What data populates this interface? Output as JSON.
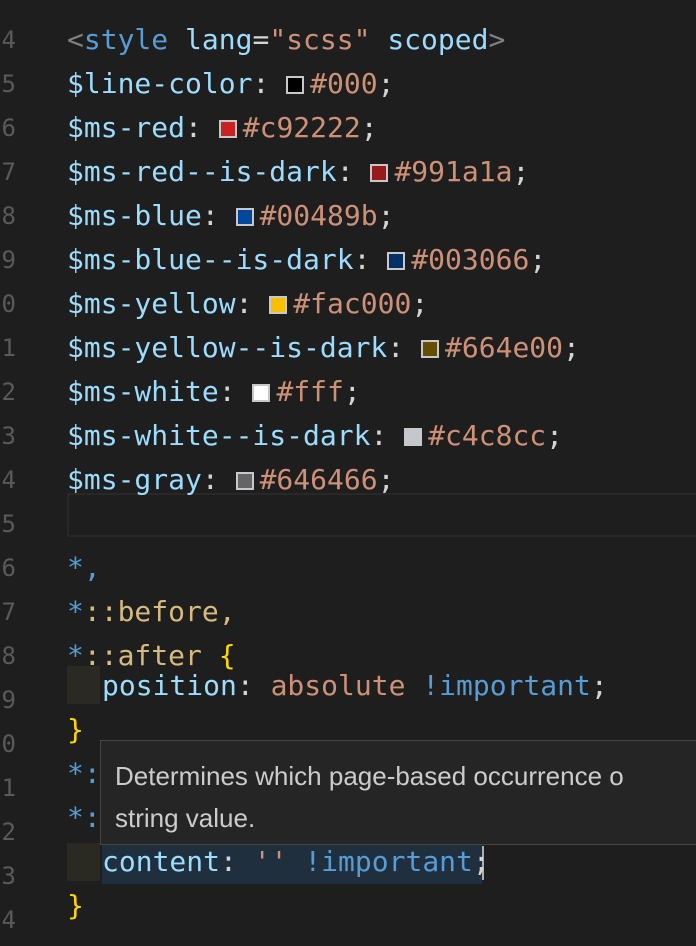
{
  "gutter_numbers": [
    "4",
    "5",
    "6",
    "7",
    "8",
    "9",
    "0",
    "1",
    "2",
    "3",
    "4",
    "5",
    "6",
    "7",
    "8",
    "9",
    "0",
    "1",
    "2",
    "3",
    "4"
  ],
  "code": {
    "l1": {
      "open": "<",
      "tag": "style",
      "attr1": "lang",
      "eq": "=",
      "str": "\"scss\"",
      "attr2": "scoped",
      "close": ">"
    },
    "vars": [
      {
        "name": "$line-color",
        "color": "#000000",
        "value": "#000"
      },
      {
        "name": "$ms-red",
        "color": "#c92222",
        "value": "#c92222"
      },
      {
        "name": "$ms-red--is-dark",
        "color": "#991a1a",
        "value": "#991a1a"
      },
      {
        "name": "$ms-blue",
        "color": "#00489b",
        "value": "#00489b"
      },
      {
        "name": "$ms-blue--is-dark",
        "color": "#003066",
        "value": "#003066"
      },
      {
        "name": "$ms-yellow",
        "color": "#fac000",
        "value": "#fac000"
      },
      {
        "name": "$ms-yellow--is-dark",
        "color": "#664e00",
        "value": "#664e00"
      },
      {
        "name": "$ms-white",
        "color": "#ffffff",
        "value": "#fff"
      },
      {
        "name": "$ms-white--is-dark",
        "color": "#c4c8cc",
        "value": "#c4c8cc"
      },
      {
        "name": "$ms-gray",
        "color": "#646466",
        "value": "#646466"
      }
    ],
    "sel1": "*,",
    "sel2_star": "*",
    "sel2_pseudo": "::before,",
    "sel3_star": "*",
    "sel3_pseudo": "::after",
    "open_brace": "{",
    "decl1_prop": "position",
    "decl1_val": "absolute",
    "decl1_imp": "!important",
    "close_brace": "}",
    "sel4_star": "*:",
    "sel5_star": "*:",
    "decl2_prop": "content",
    "decl2_val": "''",
    "decl2_imp": "!important",
    "close_brace2": "}"
  },
  "tooltip": {
    "line1": "Determines which page-based occurrence o",
    "line2": "string value."
  }
}
